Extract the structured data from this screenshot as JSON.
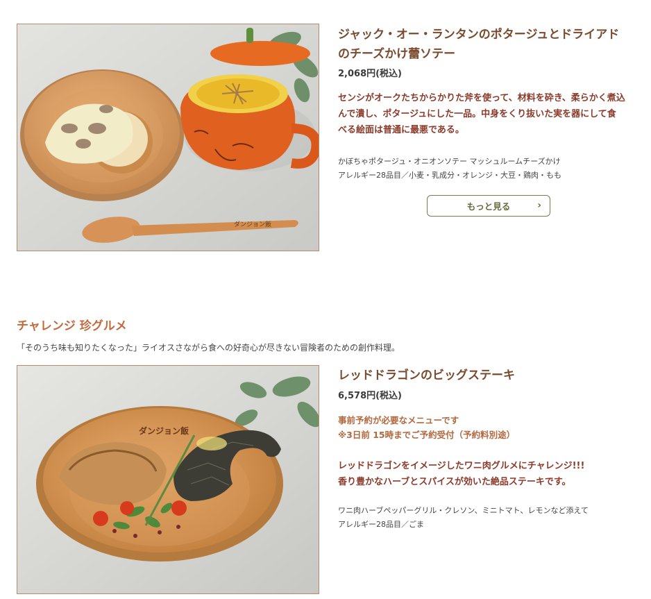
{
  "item1": {
    "image_alt": "ジャック・オー・ランタンのポタージュとドライアドのチーズかけ蕾ソテー",
    "title_line1": "ジャック・オー・ランタンのポタージュとドライアド",
    "title_line2": "のチーズかけ蕾ソテー",
    "price": "2,068円(税込)",
    "desc_line1": "センシがオークたちからかりた斧を使って、材料を砕き、柔らかく煮込",
    "desc_line2": "んで潰し、ポタージュにした一品。中身をくり抜いた実を器にして食",
    "desc_line3": "べる絵面は普通に最悪である。",
    "contents": "かぼちゃポタージュ・オニオンソテー マッシュルームチーズかけ",
    "allergy": "アレルギー28品目／小麦・乳成分・オレンジ・大豆・鶏肉・もも",
    "more_label": "もっと見る",
    "spoon_text": "ダンジョン飯"
  },
  "section": {
    "heading": "チャレンジ 珍グルメ",
    "intro": "「そのうち味も知りたくなった」ライオスさながら食への好奇心が尽きない冒険者のための創作料理。"
  },
  "item2": {
    "image_alt": "レッドドラゴンのビッグステーキ",
    "title": "レッドドラゴンのビッグステーキ",
    "price": "6,578円(税込)",
    "note_line1": "事前予約が必要なメニューです",
    "note_line2": "※3日前 15時までご予約受付（予約料別途）",
    "desc_line1": "レッドドラゴンをイメージしたワニ肉グルメにチャレンジ!!!",
    "desc_line2": "香り豊かなハーブとスパイスが効いた絶品ステーキです。",
    "contents": "ワニ肉ハーブペッパーグリル・クレソン、ミニトマト、レモンなど添えて",
    "allergy": "アレルギー28品目／ごま",
    "plate_text": "ダンジョン飯"
  },
  "colors": {
    "title": "#7a4a2e",
    "desc": "#8b3a2a",
    "note": "#b3683f",
    "heading": "#c2693c",
    "button_border": "#7a7a4e"
  }
}
